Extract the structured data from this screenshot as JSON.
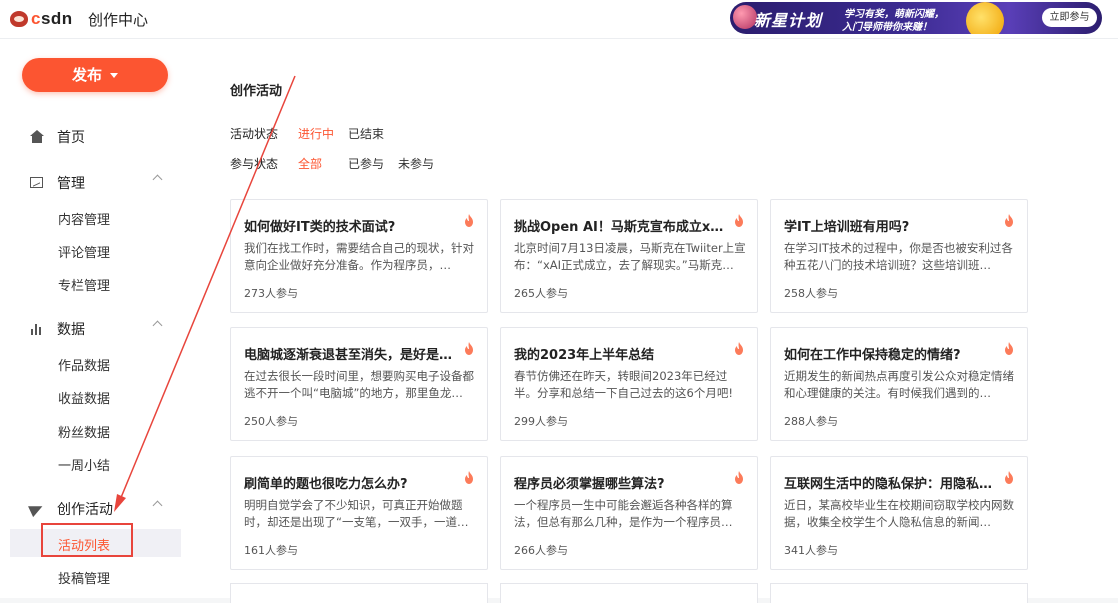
{
  "header": {
    "logo_c": "c",
    "logo_rest": "sdn",
    "title": "创作中心",
    "banner": {
      "title": "新星计划",
      "sub1": "学习有奖，萌新闪耀，",
      "sub2": "入门导师带你来赚！",
      "button": "立即参与"
    }
  },
  "sidebar": {
    "publish": "发布",
    "home": "首页",
    "manage": {
      "label": "管理",
      "items": [
        "内容管理",
        "评论管理",
        "专栏管理"
      ]
    },
    "data": {
      "label": "数据",
      "items": [
        "作品数据",
        "收益数据",
        "粉丝数据",
        "一周小结"
      ]
    },
    "activity": {
      "label": "创作活动",
      "items": [
        "活动列表",
        "投稿管理"
      ]
    }
  },
  "main": {
    "title": "创作活动",
    "filters": {
      "status_label": "活动状态",
      "status_options": [
        "进行中",
        "已结束"
      ],
      "join_label": "参与状态",
      "join_options": [
        "全部",
        "已参与",
        "未参与"
      ]
    },
    "cards": [
      {
        "title": "如何做好IT类的技术面试?",
        "desc": "我们在找工作时，需要结合自己的现状，针对意向企业做好充分准备。作为程序员，…",
        "count": "273人参与"
      },
      {
        "title": "挑战Open AI！马斯克宣布成立xAI…",
        "desc": "北京时间7月13日凌晨，马斯克在Twiiter上宣布：“xAI正式成立，去了解现实。”马斯克…",
        "count": "265人参与"
      },
      {
        "title": "学IT上培训班有用吗?",
        "desc": "在学习IT技术的过程中，你是否也被安利过各种五花八门的技术培训班？这些培训班…",
        "count": "258人参与"
      },
      {
        "title": "电脑城逐渐衰退甚至消失，是好是…",
        "desc": "在过去很长一段时间里，想要购买电子设备都逃不开一个叫“电脑城”的地方，那里鱼龙…",
        "count": "250人参与"
      },
      {
        "title": "我的2023年上半年总结",
        "desc": "春节仿佛还在昨天，转眼间2023年已经过半。分享和总结一下自己过去的这6个月吧!",
        "count": "299人参与"
      },
      {
        "title": "如何在工作中保持稳定的情绪?",
        "desc": "近期发生的新闻热点再度引发公众对稳定情绪和心理健康的关注。有时候我们遇到的…",
        "count": "288人参与"
      },
      {
        "title": "刷简单的题也很吃力怎么办?",
        "desc": "明明自觉学会了不少知识，可真正开始做题时，却还是出现了“一支笔，一双手，一道…",
        "count": "161人参与"
      },
      {
        "title": "程序员必须掌握哪些算法?",
        "desc": "一个程序员一生中可能会邂逅各种各样的算法，但总有那么几种，是作为一个程序员…",
        "count": "266人参与"
      },
      {
        "title": "互联网生活中的隐私保护：用隐私…",
        "desc": "近日，某高校毕业生在校期间窃取学校内网数据，收集全校学生个人隐私信息的新闻…",
        "count": "341人参与"
      }
    ]
  },
  "colors": {
    "accent": "#fc5531",
    "annotation": "#e8453c"
  }
}
